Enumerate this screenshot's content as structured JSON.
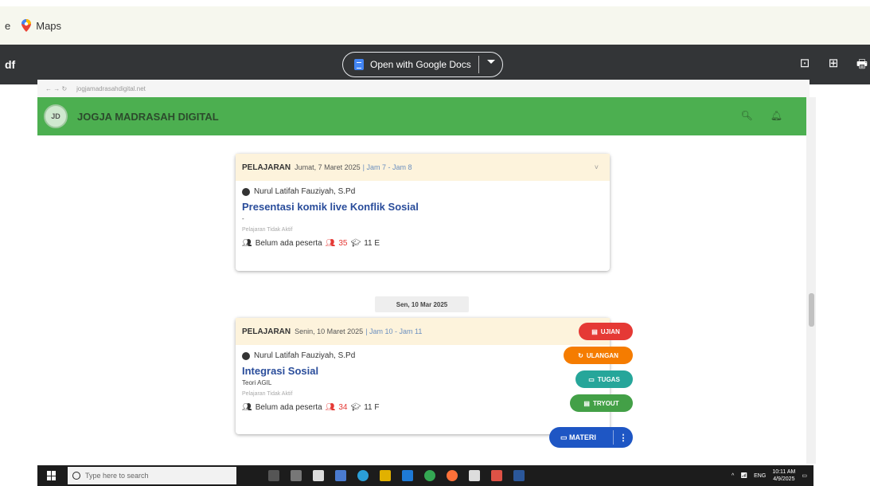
{
  "bookmarks": {
    "fragment": "e",
    "maps_label": "Maps"
  },
  "pdf_toolbar": {
    "fragment": "df",
    "open_with_label": "Open with Google Docs"
  },
  "browser_strip": {
    "url": "jogjamadrasahdigital.net"
  },
  "app": {
    "title": "JOGJA MADRASAH DIGITAL",
    "logo_text": "JD"
  },
  "cards": [
    {
      "type": "PELAJARAN",
      "date": "Jumat, 7 Maret 2025",
      "jam": "| Jam 7 - Jam 8",
      "teacher": "Nurul Latifah Fauziyah, S.Pd",
      "title": "Presentasi komik live Konflik Sosial",
      "subtitle": "-",
      "status": "Pelajaran Tidak Aktif",
      "participants": "Belum ada peserta",
      "count": "35",
      "class": "11 E"
    },
    {
      "type": "PELAJARAN",
      "date": "Senin, 10 Maret 2025",
      "jam": "| Jam 10 - Jam 11",
      "teacher": "Nurul Latifah Fauziyah, S.Pd",
      "title": "Integrasi Sosial",
      "subtitle": "Teori AGIL",
      "status": "Pelajaran Tidak Aktif",
      "participants": "Belum ada peserta",
      "count": "34",
      "class": "11 F"
    }
  ],
  "date_chip": "Sen, 10 Mar 2025",
  "fabs": {
    "ujian": "UJIAN",
    "ulangan": "ULANGAN",
    "tugas": "TUGAS",
    "tryout": "TRYOUT",
    "materi": "MATERI"
  },
  "colors": {
    "header_green": "#4caf50",
    "ujian": "#e53935",
    "ulangan": "#f57c00",
    "tugas": "#26a69a",
    "tryout": "#43a047",
    "materi": "#1e56c4"
  },
  "taskbar": {
    "search_placeholder": "Type here to search",
    "lang": "ENG",
    "time": "10:11 AM",
    "date": "4/9/2025"
  }
}
